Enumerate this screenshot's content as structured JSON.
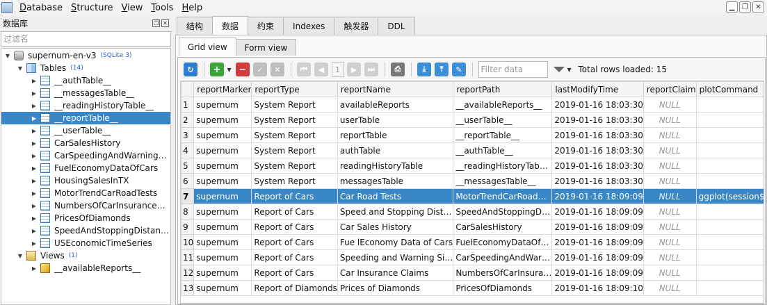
{
  "menu": [
    "Database",
    "Structure",
    "View",
    "Tools",
    "Help"
  ],
  "left_panel": {
    "title": "数据库",
    "filter_placeholder": "过滤名",
    "db_name": "supernum-en-v3",
    "db_type": "(SQLite 3)",
    "tables_label": "Tables",
    "tables_count": "(14)",
    "tables": [
      "__authTable__",
      "__messagesTable__",
      "__readingHistoryTable__",
      "__reportTable__",
      "__userTable__",
      "CarSalesHistory",
      "CarSpeedingAndWarning…",
      "FuelEconomyDataOfCars",
      "HousingSalesInTX",
      "MotorTrendCarRoadTests",
      "NumbersOfCarInsurance…",
      "PricesOfDiamonds",
      "SpeedAndStoppingDistan…",
      "USEconomicTimeSeries"
    ],
    "selected_table_index": 3,
    "views_label": "Views",
    "views_count": "(1)",
    "views": [
      "__availableReports__"
    ]
  },
  "main_tabs": [
    "结构",
    "数据",
    "约束",
    "Indexes",
    "触发器",
    "DDL"
  ],
  "active_main_tab": 1,
  "sub_tabs": [
    "Grid view",
    "Form view"
  ],
  "active_sub_tab": 0,
  "toolbar": {
    "page_number": "1",
    "filter_placeholder": "Filter data",
    "total_rows": "Total rows loaded: 15"
  },
  "grid": {
    "columns": [
      "reportMarker",
      "reportType",
      "reportName",
      "reportPath",
      "lastModifyTime",
      "reportClaim",
      "plotCommand"
    ],
    "selected_row_index": 6,
    "rows": [
      [
        "1",
        "supernum",
        "System Report",
        "availableReports",
        "__availableReports__",
        "2019-01-16 18:03:30",
        "NULL",
        ""
      ],
      [
        "2",
        "supernum",
        "System Report",
        "userTable",
        "__userTable__",
        "2019-01-16 18:03:30",
        "NULL",
        ""
      ],
      [
        "3",
        "supernum",
        "System Report",
        "reportTable",
        "__reportTable__",
        "2019-01-16 18:03:30",
        "NULL",
        ""
      ],
      [
        "4",
        "supernum",
        "System Report",
        "authTable",
        "__authTable__",
        "2019-01-16 18:03:30",
        "NULL",
        ""
      ],
      [
        "5",
        "supernum",
        "System Report",
        "readingHistoryTable",
        "__readingHistoryTab…",
        "2019-01-16 18:03:30",
        "NULL",
        ""
      ],
      [
        "6",
        "supernum",
        "System Report",
        "messagesTable",
        "__messagesTable__",
        "2019-01-16 18:03:30",
        "NULL",
        ""
      ],
      [
        "7",
        "supernum",
        "Report of Cars",
        "Car Road Tests",
        "MotorTrendCarRoad…",
        "2019-01-16 18:09:09",
        "NULL",
        "ggplot(session$r"
      ],
      [
        "8",
        "supernum",
        "Report of Cars",
        "Speed and Stopping Dist…",
        "SpeedAndStoppingD…",
        "2019-01-16 18:09:09",
        "NULL",
        ""
      ],
      [
        "9",
        "supernum",
        "Report of Cars",
        "Car Sales History",
        "CarSalesHistory",
        "2019-01-16 18:09:09",
        "NULL",
        ""
      ],
      [
        "10",
        "supernum",
        "Report of Cars",
        "Fue lEconomy Data of Cars",
        "FuelEconomyDataOf…",
        "2019-01-16 18:09:09",
        "NULL",
        ""
      ],
      [
        "11",
        "supernum",
        "Report of Cars",
        "Speeding and Warning Si…",
        "CarSpeedingAndWar…",
        "2019-01-16 18:09:09",
        "NULL",
        ""
      ],
      [
        "12",
        "supernum",
        "Report of Cars",
        "Car Insurance Claims",
        "NumbersOfCarInsura…",
        "2019-01-16 18:09:09",
        "NULL",
        ""
      ],
      [
        "13",
        "supernum",
        "Report of Diamonds",
        "Prices of Diamonds",
        "PricesOfDiamonds",
        "2019-01-16 18:09:10",
        "NULL",
        ""
      ]
    ]
  }
}
